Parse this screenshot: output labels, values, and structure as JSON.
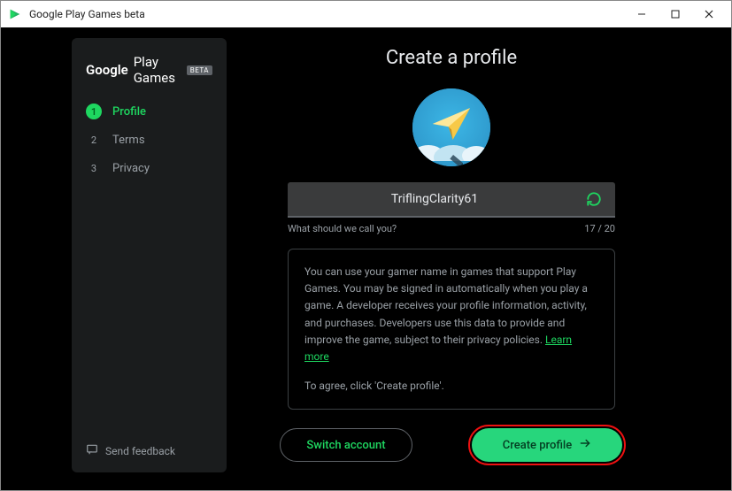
{
  "window": {
    "title": "Google Play Games beta"
  },
  "sidebar": {
    "brand_google": "Google",
    "brand_rest": "Play Games",
    "beta": "BETA",
    "steps": [
      {
        "num": "1",
        "label": "Profile",
        "active": true
      },
      {
        "num": "2",
        "label": "Terms",
        "active": false
      },
      {
        "num": "3",
        "label": "Privacy",
        "active": false
      }
    ],
    "feedback": "Send feedback"
  },
  "main": {
    "heading": "Create a profile",
    "gamer_name": "TriflingClarity61",
    "helper": "What should we call you?",
    "counter": "17 / 20",
    "info_text": "You can use your gamer name in games that support Play Games. You may be signed in automatically when you play a game. A developer receives your profile information, activity, and purchases. Developers use this data to provide and improve the game, subject to their privacy policies. ",
    "learn_more": "Learn more",
    "agree_text": "To agree, click 'Create profile'.",
    "switch_account": "Switch account",
    "create_profile": "Create profile"
  }
}
